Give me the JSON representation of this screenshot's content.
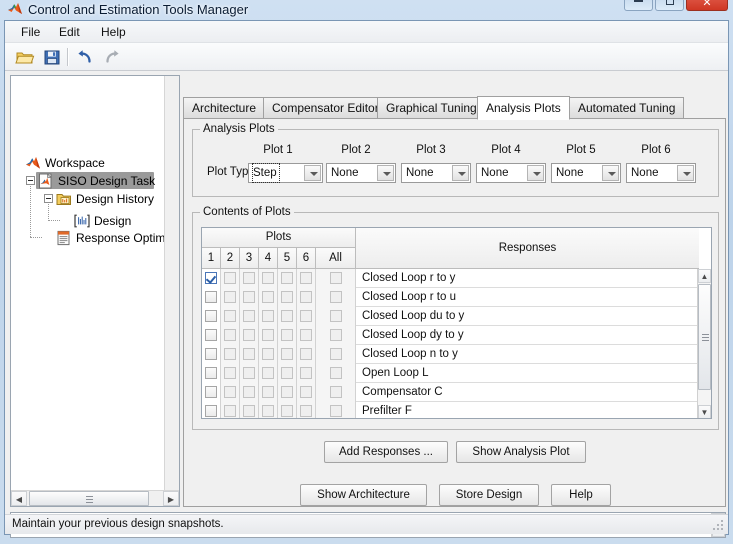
{
  "window": {
    "title": "Control and Estimation Tools Manager",
    "icon": "matlab-logo-icon",
    "controls": {
      "minimize": "minimize-button",
      "maximize": "maximize-button",
      "close": "close-button",
      "close_glyph": "✕"
    }
  },
  "menubar": {
    "items": [
      {
        "label": "File",
        "name": "menu-file"
      },
      {
        "label": "Edit",
        "name": "menu-edit"
      },
      {
        "label": "Help",
        "name": "menu-help"
      }
    ]
  },
  "toolbar": {
    "buttons": [
      {
        "name": "open-folder-icon",
        "title": "Open"
      },
      {
        "name": "save-icon",
        "title": "Save"
      },
      {
        "name": "undo-icon",
        "title": "Undo"
      },
      {
        "name": "redo-icon",
        "title": "Redo"
      }
    ]
  },
  "tree": {
    "nodes": [
      {
        "label": "Workspace",
        "icon": "matlab-logo-icon",
        "depth": 0,
        "selected": false
      },
      {
        "label": "SISO Design Task",
        "icon": "siso-design-task-icon",
        "depth": 1,
        "selected": true
      },
      {
        "label": "Design History",
        "icon": "folder-icon",
        "depth": 2,
        "selected": false
      },
      {
        "label": "Design",
        "icon": "design-snapshot-icon",
        "depth": 3,
        "selected": false
      },
      {
        "label": "Response Optimizat",
        "icon": "response-optimization-icon",
        "depth": 2,
        "selected": false
      }
    ]
  },
  "tabs": [
    {
      "label": "Architecture",
      "active": false
    },
    {
      "label": "Compensator Editor",
      "active": false
    },
    {
      "label": "Graphical Tuning",
      "active": false
    },
    {
      "label": "Analysis Plots",
      "active": true
    },
    {
      "label": "Automated Tuning",
      "active": false
    }
  ],
  "analysis_plots": {
    "group_label": "Analysis Plots",
    "plot_type_label": "Plot Type",
    "columns": [
      "Plot 1",
      "Plot 2",
      "Plot 3",
      "Plot 4",
      "Plot 5",
      "Plot 6"
    ],
    "values": [
      "Step",
      "None",
      "None",
      "None",
      "None",
      "None"
    ],
    "focused_index": 0
  },
  "contents_of_plots": {
    "group_label": "Contents of Plots",
    "plots_header": "Plots",
    "responses_header": "Responses",
    "plot_columns": [
      "1",
      "2",
      "3",
      "4",
      "5",
      "6"
    ],
    "all_column": "All",
    "rows": [
      {
        "name": "Closed Loop r to y",
        "checks": [
          true,
          false,
          false,
          false,
          false,
          false
        ],
        "all": false
      },
      {
        "name": "Closed Loop r to u",
        "checks": [
          false,
          false,
          false,
          false,
          false,
          false
        ],
        "all": false
      },
      {
        "name": "Closed Loop du to y",
        "checks": [
          false,
          false,
          false,
          false,
          false,
          false
        ],
        "all": false
      },
      {
        "name": "Closed Loop dy to y",
        "checks": [
          false,
          false,
          false,
          false,
          false,
          false
        ],
        "all": false
      },
      {
        "name": "Closed Loop n to y",
        "checks": [
          false,
          false,
          false,
          false,
          false,
          false
        ],
        "all": false
      },
      {
        "name": "Open Loop L",
        "checks": [
          false,
          false,
          false,
          false,
          false,
          false
        ],
        "all": false
      },
      {
        "name": "Compensator C",
        "checks": [
          false,
          false,
          false,
          false,
          false,
          false
        ],
        "all": false
      },
      {
        "name": "Prefilter F",
        "checks": [
          false,
          false,
          false,
          false,
          false,
          false
        ],
        "all": false
      }
    ]
  },
  "panel_buttons": {
    "add_responses": "Add Responses ...",
    "show_analysis_plot": "Show Analysis Plot"
  },
  "footer_buttons": {
    "show_architecture": "Show Architecture",
    "store_design": "Store Design",
    "help": "Help"
  },
  "log": {
    "text": ""
  },
  "statusbar": {
    "message": "Maintain your previous design snapshots."
  },
  "colors": {
    "accent": "#2c5fa8",
    "close_red": "#cf3724",
    "selection_gray": "#9a9a9a",
    "panel_bg": "#f0f0f0"
  }
}
